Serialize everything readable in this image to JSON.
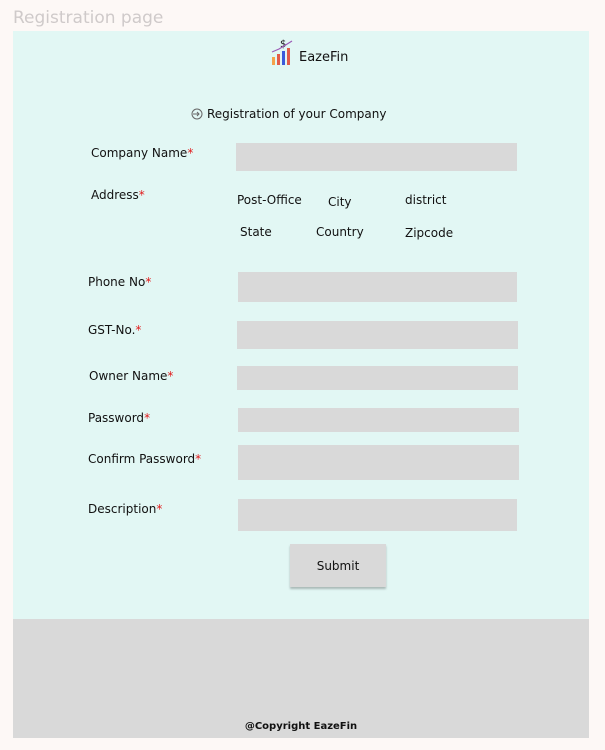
{
  "page": {
    "frame_title": "Registration page"
  },
  "header": {
    "brand": "EazeFin",
    "logo_symbol": "$"
  },
  "form": {
    "title": "Registration of your Company",
    "required_mark": "*",
    "company_name_label": "Company Name",
    "address_label": "Address",
    "address_fields": {
      "post_office": "Post-Office",
      "city": "City",
      "district": "district",
      "state": "State",
      "country": "Country",
      "zipcode": "Zipcode"
    },
    "phone_label": "Phone No",
    "gst_label": "GST-No.",
    "owner_label": "Owner Name",
    "password_label": "Password",
    "confirm_password_label": "Confirm Password",
    "description_label": "Description",
    "submit_label": "Submit"
  },
  "footer": {
    "copyright": "@Copyright EazeFin"
  },
  "colors": {
    "panel": "#e2f7f4",
    "field": "#d9d9d9",
    "required": "#e11b1b",
    "footer": "#d9d9d9"
  }
}
